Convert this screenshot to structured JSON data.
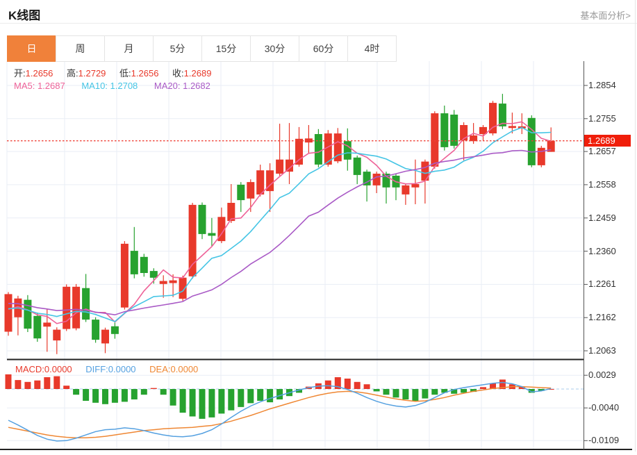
{
  "header": {
    "title": "K线图",
    "link": "基本面分析>"
  },
  "tabs": {
    "items": [
      "日",
      "周",
      "月",
      "5分",
      "15分",
      "30分",
      "60分",
      "4时"
    ],
    "active_index": 0
  },
  "readout": {
    "o_label": "开:",
    "o": "1.2656",
    "h_label": "高:",
    "h": "1.2729",
    "l_label": "低:",
    "l": "1.2656",
    "c_label": "收:",
    "c": "1.2689"
  },
  "ma_readout": {
    "ma5": "MA5: 1.2687",
    "ma10": "MA10: 1.2708",
    "ma20": "MA20: 1.2682"
  },
  "macd_readout": {
    "macd": "MACD:0.0000",
    "diff": "DIFF:0.0000",
    "dea": "DEA:0.0000"
  },
  "price_axis": {
    "ticks": [
      "1.2854",
      "1.2755",
      "1.2657",
      "1.2558",
      "1.2459",
      "1.2360",
      "1.2261",
      "1.2162",
      "1.2063"
    ],
    "current": "1.2689"
  },
  "macd_axis": {
    "ticks": [
      "0.0029",
      "-0.0040",
      "-0.0109"
    ]
  },
  "colors": {
    "up": "#e8392b",
    "down": "#27a22f",
    "ma5": "#ee6298",
    "ma10": "#45c5e5",
    "ma20": "#a95ac6",
    "diff": "#54a0e0",
    "dea": "#ef8733",
    "accent": "#f0813a",
    "badge": "#f01e0a",
    "dotted": "#ef4136",
    "grid": "#e9eef5",
    "zero_dash": "#a8cdec",
    "axis_line": "#555",
    "dark_line": "#222",
    "link": "#999999"
  },
  "chart_data": [
    {
      "type": "candlestick",
      "title": "K线图 日线",
      "ohlc_format": [
        "open",
        "close",
        "low",
        "high"
      ],
      "ylim": [
        1.2063,
        1.2854
      ],
      "y_ticks": [
        1.2854,
        1.2755,
        1.2657,
        1.2558,
        1.2459,
        1.236,
        1.2261,
        1.2162,
        1.2063
      ],
      "current_price": 1.2689,
      "last_ohlc": {
        "open": 1.2656,
        "high": 1.2729,
        "low": 1.2656,
        "close": 1.2689
      },
      "ma_display": {
        "MA5": 1.2687,
        "MA10": 1.2708,
        "MA20": 1.2682
      },
      "ma_windows": [
        5,
        10,
        20
      ],
      "ma_prehistory_closes": [
        1.2238,
        1.2234,
        1.223,
        1.2226,
        1.2222,
        1.2218,
        1.2214,
        1.221,
        1.2206,
        1.2202,
        1.2198,
        1.2194,
        1.219,
        1.2186,
        1.2183,
        1.218,
        1.2177,
        1.2174,
        1.2171
      ],
      "candles": [
        [
          1.212,
          1.2232,
          1.2108,
          1.2238
        ],
        [
          1.2163,
          1.2219,
          1.2109,
          1.2227
        ],
        [
          1.2215,
          1.2129,
          1.2119,
          1.2229
        ],
        [
          1.2167,
          1.21,
          1.209,
          1.2177
        ],
        [
          1.2135,
          1.2147,
          1.206,
          1.2188
        ],
        [
          1.2094,
          1.2126,
          1.2053,
          1.2133
        ],
        [
          1.2128,
          1.2254,
          1.2122,
          1.2261
        ],
        [
          1.213,
          1.2254,
          1.2124,
          1.2262
        ],
        [
          1.225,
          1.2156,
          1.2149,
          1.2292
        ],
        [
          1.2156,
          1.2096,
          1.2087,
          1.2163
        ],
        [
          1.2085,
          1.2126,
          1.2056,
          1.2132
        ],
        [
          1.2136,
          1.2113,
          1.2099,
          1.2147
        ],
        [
          1.2192,
          1.2382,
          1.2186,
          1.239
        ],
        [
          1.2361,
          1.2291,
          1.2279,
          1.2432
        ],
        [
          1.2343,
          1.2295,
          1.2284,
          1.2352
        ],
        [
          1.2301,
          1.2281,
          1.2263,
          1.2309
        ],
        [
          1.2262,
          1.2271,
          1.2221,
          1.2288
        ],
        [
          1.2265,
          1.2273,
          1.2223,
          1.2291
        ],
        [
          1.2218,
          1.2281,
          1.2212,
          1.2287
        ],
        [
          1.2285,
          1.2498,
          1.2278,
          1.2504
        ],
        [
          1.2498,
          1.2411,
          1.2396,
          1.2505
        ],
        [
          1.2414,
          1.2406,
          1.2375,
          1.2459
        ],
        [
          1.239,
          1.2462,
          1.2384,
          1.249
        ],
        [
          1.245,
          1.2504,
          1.2444,
          1.256
        ],
        [
          1.2558,
          1.2512,
          1.2477,
          1.2566
        ],
        [
          1.2517,
          1.2566,
          1.2477,
          1.2574
        ],
        [
          1.2529,
          1.2601,
          1.2523,
          1.2618
        ],
        [
          1.2539,
          1.2601,
          1.2477,
          1.2622
        ],
        [
          1.2591,
          1.2633,
          1.2585,
          1.274
        ],
        [
          1.2597,
          1.2633,
          1.256,
          1.2742
        ],
        [
          1.2618,
          1.2695,
          1.2612,
          1.273
        ],
        [
          1.2684,
          1.2696,
          1.2653,
          1.2736
        ],
        [
          1.2709,
          1.2618,
          1.261,
          1.2724
        ],
        [
          1.2618,
          1.2711,
          1.2612,
          1.2721
        ],
        [
          1.2628,
          1.2711,
          1.2622,
          1.2727
        ],
        [
          1.2688,
          1.2633,
          1.26,
          1.2726
        ],
        [
          1.2639,
          1.2587,
          1.256,
          1.2645
        ],
        [
          1.2597,
          1.2556,
          1.2508,
          1.2603
        ],
        [
          1.2556,
          1.2591,
          1.2533,
          1.2597
        ],
        [
          1.2591,
          1.255,
          1.2502,
          1.2597
        ],
        [
          1.2585,
          1.255,
          1.2512,
          1.2591
        ],
        [
          1.2529,
          1.2556,
          1.2498,
          1.2562
        ],
        [
          1.255,
          1.256,
          1.25,
          1.2633
        ],
        [
          1.257,
          1.2627,
          1.2502,
          1.2633
        ],
        [
          1.2612,
          1.2771,
          1.2606,
          1.2777
        ],
        [
          1.2771,
          1.267,
          1.266,
          1.2794
        ],
        [
          1.2767,
          1.2674,
          1.2666,
          1.2781
        ],
        [
          1.269,
          1.2736,
          1.2631,
          1.2744
        ],
        [
          1.2688,
          1.2705,
          1.268,
          1.2742
        ],
        [
          1.2709,
          1.273,
          1.269,
          1.2736
        ],
        [
          1.2711,
          1.2802,
          1.2705,
          1.2808
        ],
        [
          1.28,
          1.2732,
          1.2724,
          1.2829
        ],
        [
          1.2727,
          1.2733,
          1.2711,
          1.2773
        ],
        [
          1.2726,
          1.2732,
          1.2709,
          1.2771
        ],
        [
          1.2757,
          1.2616,
          1.261,
          1.2765
        ],
        [
          1.2616,
          1.2668,
          1.261,
          1.2674
        ],
        [
          1.2656,
          1.2689,
          1.2656,
          1.2729
        ]
      ]
    },
    {
      "type": "bar",
      "title": "MACD",
      "y_ticks": [
        0.0029,
        -0.004,
        -0.0109
      ],
      "readout": {
        "MACD": 0.0,
        "DIFF": 0.0,
        "DEA": 0.0
      },
      "values": [
        0.0031,
        0.0019,
        0.0015,
        0.0018,
        0.0025,
        0.0027,
        0.0007,
        -0.0012,
        -0.0025,
        -0.0029,
        -0.0032,
        -0.0029,
        -0.0027,
        -0.0022,
        -0.0012,
        0.0002,
        -0.0012,
        -0.0035,
        -0.005,
        -0.0058,
        -0.0063,
        -0.006,
        -0.0052,
        -0.0045,
        -0.0038,
        -0.003,
        -0.0025,
        -0.0028,
        -0.0022,
        -0.0015,
        -0.0008,
        0.0005,
        0.0012,
        0.0018,
        0.0025,
        0.0022,
        0.0015,
        0.001,
        -0.0005,
        -0.0012,
        -0.0018,
        -0.0022,
        -0.0025,
        -0.002,
        -0.0012,
        -0.0008,
        -0.001,
        -0.0008,
        -0.0006,
        0.0004,
        0.0012,
        0.002,
        0.001,
        0.0005,
        -0.0008,
        -0.0004,
        0.0
      ],
      "diff": [
        -0.0066,
        -0.0076,
        -0.0087,
        -0.0098,
        -0.0106,
        -0.011,
        -0.0109,
        -0.0104,
        -0.0097,
        -0.009,
        -0.0086,
        -0.0085,
        -0.0082,
        -0.0084,
        -0.0088,
        -0.0093,
        -0.0097,
        -0.01,
        -0.0101,
        -0.0099,
        -0.0094,
        -0.0086,
        -0.0074,
        -0.006,
        -0.0047,
        -0.0036,
        -0.0027,
        -0.002,
        -0.0014,
        -0.0008,
        -0.0002,
        0.0003,
        0.0006,
        0.0007,
        0.0005,
        -0.0001,
        -0.0009,
        -0.0018,
        -0.0026,
        -0.0032,
        -0.0036,
        -0.0038,
        -0.0035,
        -0.0028,
        -0.0018,
        -0.0008,
        -0.0001,
        0.0003,
        0.0006,
        0.0009,
        0.0012,
        0.0014,
        0.0011,
        0.0005,
        -0.0006,
        -0.0004,
        0.0001
      ],
      "dea": [
        -0.0081,
        -0.0085,
        -0.0089,
        -0.0093,
        -0.0097,
        -0.01,
        -0.0102,
        -0.0103,
        -0.0103,
        -0.0102,
        -0.01,
        -0.0097,
        -0.0094,
        -0.0091,
        -0.0088,
        -0.0086,
        -0.0084,
        -0.0083,
        -0.0082,
        -0.0081,
        -0.0079,
        -0.0077,
        -0.0073,
        -0.0068,
        -0.0062,
        -0.0056,
        -0.0049,
        -0.0042,
        -0.0036,
        -0.003,
        -0.0024,
        -0.0018,
        -0.0013,
        -0.0009,
        -0.0006,
        -0.0005,
        -0.0006,
        -0.0009,
        -0.0013,
        -0.0017,
        -0.0021,
        -0.0024,
        -0.0026,
        -0.0025,
        -0.0022,
        -0.0018,
        -0.0013,
        -0.0009,
        -0.0005,
        -0.0002,
        0.0001,
        0.0003,
        0.0005,
        0.0005,
        0.0004,
        0.0003,
        0.0002
      ]
    }
  ]
}
